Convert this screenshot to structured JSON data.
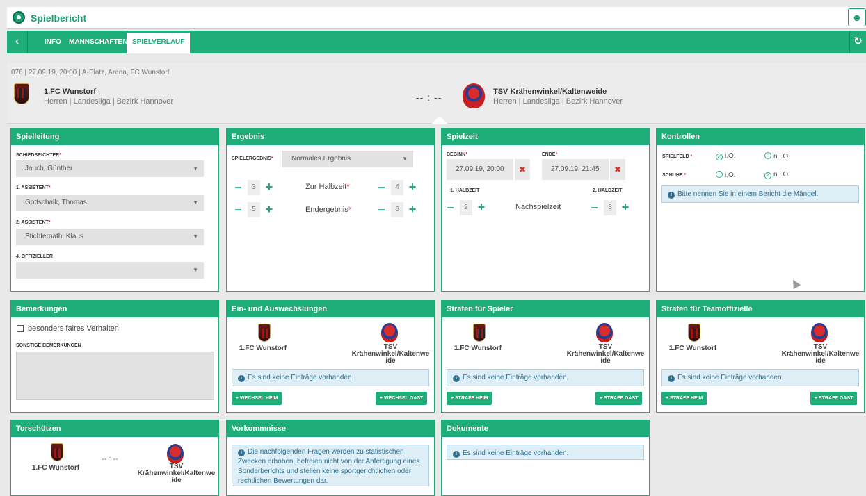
{
  "header": {
    "title": "Spielbericht"
  },
  "nav": {
    "tabs": [
      "INFO",
      "MANNSCHAFTEN",
      "SPIELVERLAUF"
    ]
  },
  "match": {
    "info": "076 | 27.09.19, 20:00 | A-Platz, Arena, FC Wunstorf",
    "home": {
      "name": "1.FC Wunstorf",
      "league": "Herren | Landesliga | Bezirk Hannover"
    },
    "away": {
      "name": "TSV Krähenwinkel/Kaltenweide",
      "league": "Herren | Landesliga | Bezirk Hannover"
    },
    "score": "-- : --"
  },
  "spielleitung": {
    "title": "Spielleitung",
    "schiedsrichter_label": "SCHIEDSRICHTER",
    "schiedsrichter": "Jauch, Günther",
    "assistent1_label": "1. ASSISTENT",
    "assistent1": "Gottschalk, Thomas",
    "assistent2_label": "2. ASSISTENT",
    "assistent2": "Stichternath, Klaus",
    "offizieller_label": "4. OFFIZIELLER",
    "offizieller": ""
  },
  "ergebnis": {
    "title": "Ergebnis",
    "label": "SPIELERGEBNIS",
    "value": "Normales Ergebnis",
    "halbzeit_label": "Zur Halbzeit",
    "endergebnis_label": "Endergebnis",
    "halbzeit_home": "3",
    "halbzeit_away": "4",
    "end_home": "5",
    "end_away": "6"
  },
  "spielzeit": {
    "title": "Spielzeit",
    "beginn_label": "BEGINN",
    "beginn": "27.09.19, 20:00",
    "ende_label": "ENDE",
    "ende": "27.09.19, 21:45",
    "halbzeit1_label": "1. HALBZEIT",
    "halbzeit2_label": "2. HALBZEIT",
    "halbzeit1": "2",
    "halbzeit2": "3",
    "nachspielzeit_label": "Nachspielzeit"
  },
  "kontrollen": {
    "title": "Kontrollen",
    "spielfeld_label": "SPIELFELD",
    "schuhe_label": "SCHUHE",
    "io": "i.O.",
    "nio": "n.i.O.",
    "info": "Bitte nennen Sie in einem Bericht die Mängel."
  },
  "bemerkungen": {
    "title": "Bemerkungen",
    "fair_label": "besonders faires Verhalten",
    "sonstige_label": "SONSTIGE BEMERKUNGEN"
  },
  "wechsel": {
    "title": "Ein- und Auswechslungen",
    "btn_home": "+ WECHSEL HEIM",
    "btn_away": "+ WECHSEL GAST"
  },
  "strafen_spieler": {
    "title": "Strafen für Spieler",
    "btn_home": "+ STRAFE HEIM",
    "btn_away": "+ STRAFE GAST"
  },
  "strafen_team": {
    "title": "Strafen für Teamoffizielle",
    "btn_home": "+ STRAFE HEIM",
    "btn_away": "+ STRAFE GAST"
  },
  "empty_text": "Es sind keine Einträge vorhanden.",
  "team_home_short": "1.FC Wunstorf",
  "team_away_wrapped": [
    "TSV",
    "Krähenwinkel/Kaltenwe",
    "ide"
  ],
  "torschuetzen": {
    "title": "Torschützen",
    "score": "-- : --"
  },
  "vorkommnisse": {
    "title": "Vorkommnisse",
    "info": "Die nachfolgenden Fragen werden zu statistischen Zwecken erhoben, befreien nicht von der Anfertigung eines Sonderberichts und stellen keine sportgerichtlichen oder rechtlichen Bewertungen dar."
  },
  "dokumente": {
    "title": "Dokumente"
  }
}
